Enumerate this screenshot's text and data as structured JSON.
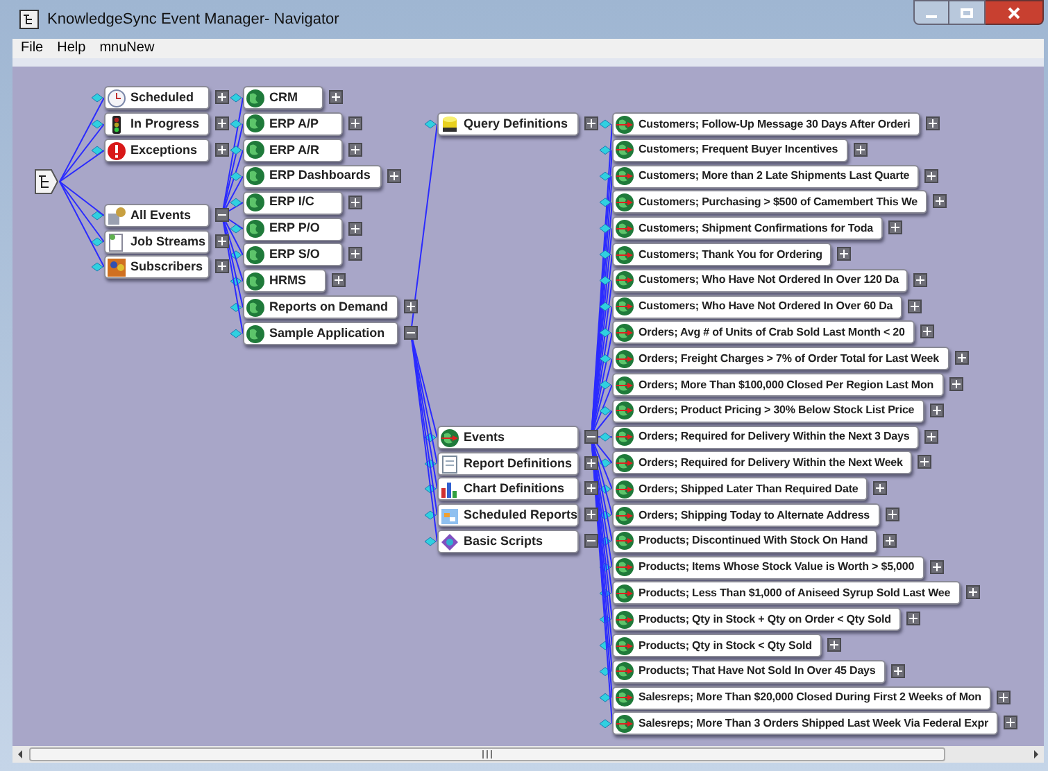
{
  "window": {
    "title": "KnowledgeSync Event Manager- Navigator"
  },
  "menu": [
    "File",
    "Help",
    "mnuNew"
  ],
  "tree": {
    "children": [
      {
        "label": "Scheduled",
        "expanded": false
      },
      {
        "label": "In Progress",
        "expanded": false
      },
      {
        "label": "Exceptions",
        "expanded": false
      },
      {
        "label": "All Events",
        "expanded": true,
        "children": [
          {
            "label": "CRM",
            "expanded": false
          },
          {
            "label": "ERP A/P",
            "expanded": false
          },
          {
            "label": "ERP A/R",
            "expanded": false
          },
          {
            "label": "ERP Dashboards",
            "expanded": false
          },
          {
            "label": "ERP I/C",
            "expanded": false
          },
          {
            "label": "ERP P/O",
            "expanded": false
          },
          {
            "label": "ERP S/O",
            "expanded": false
          },
          {
            "label": "HRMS",
            "expanded": false
          },
          {
            "label": "Reports on Demand",
            "expanded": false
          },
          {
            "label": "Sample Application",
            "expanded": true,
            "children": [
              {
                "label": "Query Definitions",
                "expanded": false
              },
              {
                "label": "Events",
                "expanded": true,
                "children": [
                  {
                    "label": "Customers; Follow-Up Message 30 Days After Orderi",
                    "expanded": false
                  },
                  {
                    "label": "Customers; Frequent Buyer Incentives",
                    "expanded": false
                  },
                  {
                    "label": "Customers; More than 2 Late Shipments Last Quarte",
                    "expanded": false
                  },
                  {
                    "label": "Customers; Purchasing > $500 of Camembert This We",
                    "expanded": false
                  },
                  {
                    "label": "Customers; Shipment Confirmations for Toda",
                    "expanded": false
                  },
                  {
                    "label": "Customers; Thank You for Ordering",
                    "expanded": false
                  },
                  {
                    "label": "Customers; Who Have Not Ordered In Over 120 Da",
                    "expanded": false
                  },
                  {
                    "label": "Customers; Who Have Not Ordered In Over 60 Da",
                    "expanded": false
                  },
                  {
                    "label": "Orders; Avg # of Units of Crab Sold Last Month < 20",
                    "expanded": false
                  },
                  {
                    "label": "Orders; Freight Charges > 7% of Order Total for Last Week",
                    "expanded": false
                  },
                  {
                    "label": "Orders; More Than $100,000 Closed Per Region Last Mon",
                    "expanded": false
                  },
                  {
                    "label": "Orders; Product Pricing > 30% Below Stock List Price",
                    "expanded": false
                  },
                  {
                    "label": "Orders; Required for Delivery Within the Next 3 Days",
                    "expanded": false
                  },
                  {
                    "label": "Orders; Required for Delivery Within the Next Week",
                    "expanded": false
                  },
                  {
                    "label": "Orders; Shipped Later Than Required Date",
                    "expanded": false
                  },
                  {
                    "label": "Orders; Shipping Today to Alternate Address",
                    "expanded": false
                  },
                  {
                    "label": "Products; Discontinued With Stock On Hand",
                    "expanded": false
                  },
                  {
                    "label": "Products; Items Whose Stock Value is Worth > $5,000",
                    "expanded": false
                  },
                  {
                    "label": "Products; Less Than $1,000 of Aniseed Syrup Sold Last Wee",
                    "expanded": false
                  },
                  {
                    "label": "Products; Qty in Stock + Qty on Order < Qty Sold",
                    "expanded": false
                  },
                  {
                    "label": "Products; Qty in Stock < Qty Sold",
                    "expanded": false
                  },
                  {
                    "label": "Products; That Have Not Sold In Over 45 Days",
                    "expanded": false
                  },
                  {
                    "label": "Salesreps; More Than $20,000 Closed During First 2 Weeks of Mon",
                    "expanded": false
                  },
                  {
                    "label": "Salesreps; More Than 3 Orders Shipped Last Week Via Federal Expr",
                    "expanded": false
                  }
                ]
              },
              {
                "label": "Report Definitions",
                "expanded": false
              },
              {
                "label": "Chart Definitions",
                "expanded": false
              },
              {
                "label": "Scheduled Reports",
                "expanded": false
              },
              {
                "label": "Basic Scripts",
                "expanded": true
              }
            ]
          }
        ]
      },
      {
        "label": "Job Streams",
        "expanded": false
      },
      {
        "label": "Subscribers",
        "expanded": false
      }
    ]
  }
}
